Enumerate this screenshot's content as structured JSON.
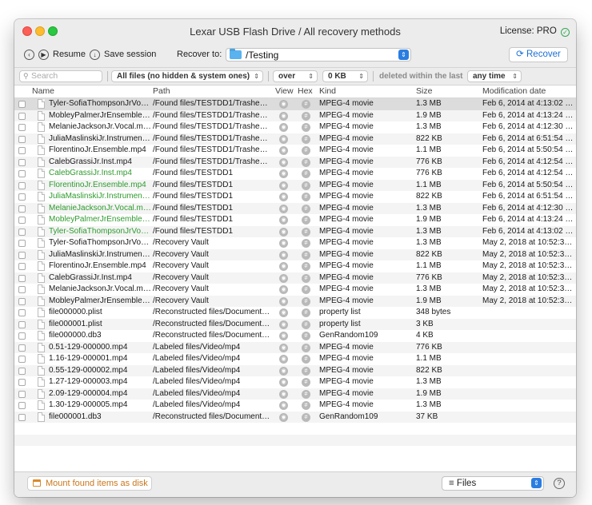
{
  "window": {
    "title": "Lexar USB Flash Drive / All recovery methods",
    "license": "License: PRO"
  },
  "toolbar": {
    "resume_label": "Resume",
    "save_session_label": "Save session",
    "recover_to_label": "Recover to:",
    "recover_to_value": "/Testing",
    "recover_button": "Recover"
  },
  "filter": {
    "search_placeholder": "Search",
    "file_filter": "All files (no hidden & system ones)",
    "size_op": "over",
    "size_value": "0 KB",
    "deleted_label": "deleted within the last",
    "time_value": "any time"
  },
  "table": {
    "columns": {
      "name": "Name",
      "path": "Path",
      "view": "View",
      "hex": "Hex",
      "kind": "Kind",
      "size": "Size",
      "mod": "Modification date"
    },
    "rows": [
      {
        "name": "Tyler-SofiaThompsonJrVocal...",
        "path": "/Found files/TESTDD1/Trashes/5...",
        "kind": "MPEG-4 movie",
        "size": "1.3 MB",
        "mod": "Feb 6, 2014 at 4:13:02 PM",
        "green": false,
        "selected": true
      },
      {
        "name": "MobleyPalmerJrEnsemble.m...",
        "path": "/Found files/TESTDD1/Trashes/5...",
        "kind": "MPEG-4 movie",
        "size": "1.9 MB",
        "mod": "Feb 6, 2014 at 4:13:24 PM",
        "green": false
      },
      {
        "name": "MelanieJacksonJr.Vocal.mp4",
        "path": "/Found files/TESTDD1/Trashes/5...",
        "kind": "MPEG-4 movie",
        "size": "1.3 MB",
        "mod": "Feb 6, 2014 at 4:12:30 PM",
        "green": false
      },
      {
        "name": "JuliaMaslinskiJr.Instrumental...",
        "path": "/Found files/TESTDD1/Trashes/5...",
        "kind": "MPEG-4 movie",
        "size": "822 KB",
        "mod": "Feb 6, 2014 at 6:51:54 PM",
        "green": false
      },
      {
        "name": "FlorentinoJr.Ensemble.mp4",
        "path": "/Found files/TESTDD1/Trashes/5...",
        "kind": "MPEG-4 movie",
        "size": "1.1 MB",
        "mod": "Feb 6, 2014 at 5:50:54 PM",
        "green": false
      },
      {
        "name": "CalebGrassiJr.Inst.mp4",
        "path": "/Found files/TESTDD1/Trashes/5...",
        "kind": "MPEG-4 movie",
        "size": "776 KB",
        "mod": "Feb 6, 2014 at 4:12:54 PM",
        "green": false
      },
      {
        "name": "CalebGrassiJr.Inst.mp4",
        "path": "/Found files/TESTDD1",
        "kind": "MPEG-4 movie",
        "size": "776 KB",
        "mod": "Feb 6, 2014 at 4:12:54 PM",
        "green": true
      },
      {
        "name": "FlorentinoJr.Ensemble.mp4",
        "path": "/Found files/TESTDD1",
        "kind": "MPEG-4 movie",
        "size": "1.1 MB",
        "mod": "Feb 6, 2014 at 5:50:54 PM",
        "green": true
      },
      {
        "name": "JuliaMaslinskiJr.Instrumental...",
        "path": "/Found files/TESTDD1",
        "kind": "MPEG-4 movie",
        "size": "822 KB",
        "mod": "Feb 6, 2014 at 6:51:54 PM",
        "green": true
      },
      {
        "name": "MelanieJacksonJr.Vocal.mp4",
        "path": "/Found files/TESTDD1",
        "kind": "MPEG-4 movie",
        "size": "1.3 MB",
        "mod": "Feb 6, 2014 at 4:12:30 PM",
        "green": true
      },
      {
        "name": "MobleyPalmerJrEnsemble.m...",
        "path": "/Found files/TESTDD1",
        "kind": "MPEG-4 movie",
        "size": "1.9 MB",
        "mod": "Feb 6, 2014 at 4:13:24 PM",
        "green": true
      },
      {
        "name": "Tyler-SofiaThompsonJrVocal...",
        "path": "/Found files/TESTDD1",
        "kind": "MPEG-4 movie",
        "size": "1.3 MB",
        "mod": "Feb 6, 2014 at 4:13:02 PM",
        "green": true
      },
      {
        "name": "Tyler-SofiaThompsonJrVocal...",
        "path": "/Recovery Vault",
        "kind": "MPEG-4 movie",
        "size": "1.3 MB",
        "mod": "May 2, 2018 at 10:52:36...",
        "green": false
      },
      {
        "name": "JuliaMaslinskiJr.Instrumental...",
        "path": "/Recovery Vault",
        "kind": "MPEG-4 movie",
        "size": "822 KB",
        "mod": "May 2, 2018 at 10:52:36...",
        "green": false
      },
      {
        "name": "FlorentinoJr.Ensemble.mp4",
        "path": "/Recovery Vault",
        "kind": "MPEG-4 movie",
        "size": "1.1 MB",
        "mod": "May 2, 2018 at 10:52:36...",
        "green": false
      },
      {
        "name": "CalebGrassiJr.Inst.mp4",
        "path": "/Recovery Vault",
        "kind": "MPEG-4 movie",
        "size": "776 KB",
        "mod": "May 2, 2018 at 10:52:36...",
        "green": false
      },
      {
        "name": "MelanieJacksonJr.Vocal.mp4",
        "path": "/Recovery Vault",
        "kind": "MPEG-4 movie",
        "size": "1.3 MB",
        "mod": "May 2, 2018 at 10:52:36...",
        "green": false
      },
      {
        "name": "MobleyPalmerJrEnsemble.m...",
        "path": "/Recovery Vault",
        "kind": "MPEG-4 movie",
        "size": "1.9 MB",
        "mod": "May 2, 2018 at 10:52:36...",
        "green": false
      },
      {
        "name": "file000000.plist",
        "path": "/Reconstructed files/Documents...",
        "kind": "property list",
        "size": "348 bytes",
        "mod": "",
        "green": false
      },
      {
        "name": "file000001.plist",
        "path": "/Reconstructed files/Documents...",
        "kind": "property list",
        "size": "3 KB",
        "mod": "",
        "green": false
      },
      {
        "name": "file000000.db3",
        "path": "/Reconstructed files/Documents...",
        "kind": "GenRandom109",
        "size": "4 KB",
        "mod": "",
        "green": false
      },
      {
        "name": "0.51-129-000000.mp4",
        "path": "/Labeled files/Video/mp4",
        "kind": "MPEG-4 movie",
        "size": "776 KB",
        "mod": "",
        "green": false
      },
      {
        "name": "1.16-129-000001.mp4",
        "path": "/Labeled files/Video/mp4",
        "kind": "MPEG-4 movie",
        "size": "1.1 MB",
        "mod": "",
        "green": false
      },
      {
        "name": "0.55-129-000002.mp4",
        "path": "/Labeled files/Video/mp4",
        "kind": "MPEG-4 movie",
        "size": "822 KB",
        "mod": "",
        "green": false
      },
      {
        "name": "1.27-129-000003.mp4",
        "path": "/Labeled files/Video/mp4",
        "kind": "MPEG-4 movie",
        "size": "1.3 MB",
        "mod": "",
        "green": false
      },
      {
        "name": "2.09-129-000004.mp4",
        "path": "/Labeled files/Video/mp4",
        "kind": "MPEG-4 movie",
        "size": "1.9 MB",
        "mod": "",
        "green": false
      },
      {
        "name": "1.30-129-000005.mp4",
        "path": "/Labeled files/Video/mp4",
        "kind": "MPEG-4 movie",
        "size": "1.3 MB",
        "mod": "",
        "green": false
      },
      {
        "name": "file000001.db3",
        "path": "/Reconstructed files/Documents...",
        "kind": "GenRandom109",
        "size": "37 KB",
        "mod": "",
        "green": false
      }
    ]
  },
  "bottom": {
    "mount_label": "Mount found items as disk",
    "view_select": "Files",
    "help": "?"
  },
  "colors": {
    "accent": "#2a7de1",
    "green_text": "#2e9b2e",
    "mount_orange": "#c9771c"
  }
}
